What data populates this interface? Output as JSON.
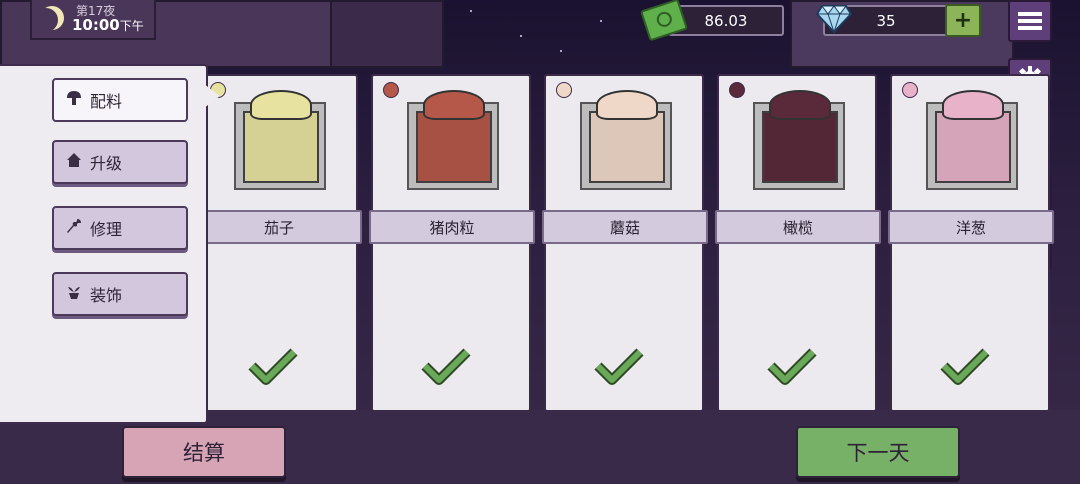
{
  "hud": {
    "night": "第17夜",
    "clock": "10:00",
    "clock_suffix": "下午",
    "money": "86.03",
    "gems": "35",
    "add_label": "+"
  },
  "sidebar_tabs": [
    {
      "label": "配料",
      "icon": "mushroom-icon",
      "active": true
    },
    {
      "label": "升级",
      "icon": "house-icon",
      "active": false
    },
    {
      "label": "修理",
      "icon": "wrench-icon",
      "active": false
    },
    {
      "label": "装饰",
      "icon": "plant-pot-icon",
      "active": false
    }
  ],
  "ingredients": [
    {
      "name": "茄子",
      "color": "#e8e2a0",
      "checked": true
    },
    {
      "name": "猪肉粒",
      "color": "#b5584a",
      "checked": true
    },
    {
      "name": "蘑菇",
      "color": "#f0d8c8",
      "checked": true
    },
    {
      "name": "橄榄",
      "color": "#5a2a3a",
      "checked": true
    },
    {
      "name": "洋葱",
      "color": "#e8b2c8",
      "checked": true
    }
  ],
  "right_menu": [
    "menu-icon",
    "gear-icon",
    "profile-icon",
    "book-icon",
    "home-icon"
  ],
  "buttons": {
    "settle": "结算",
    "next_day": "下一天"
  },
  "colors": {
    "accent_purple": "#5e3f7a",
    "check_green": "#6aa85a",
    "next_green": "#77b067",
    "settle_pink": "#d7a4b6"
  }
}
